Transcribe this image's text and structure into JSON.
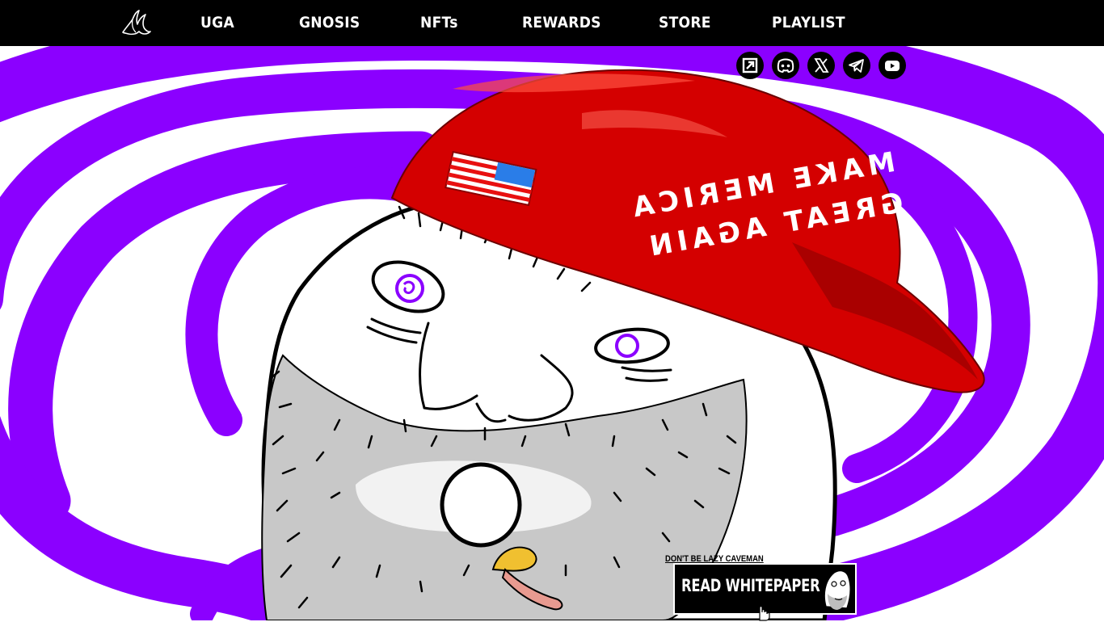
{
  "nav": {
    "logo_icon": "banana-peel-icon",
    "items": [
      {
        "label": "UGA"
      },
      {
        "label": "GNOSIS"
      },
      {
        "label": "NFTs"
      },
      {
        "label": "REWARDS"
      },
      {
        "label": "STORE"
      },
      {
        "label": "PLAYLIST"
      }
    ]
  },
  "socials": [
    {
      "icon": "chart-icon"
    },
    {
      "icon": "discord-icon"
    },
    {
      "icon": "x-icon"
    },
    {
      "icon": "telegram-icon"
    },
    {
      "icon": "youtube-icon"
    }
  ],
  "hero": {
    "cap_text_line1": "MAKE MERICA",
    "cap_text_line2": "GREAT AGAIN"
  },
  "whitepaper": {
    "caption": "DON'T BE LAZY CAVEMAN",
    "button_label": "READ WHITEPAPER"
  },
  "colors": {
    "nav_bg": "#000000",
    "spiral_purple": "#8b00ff",
    "cap_red": "#d40000"
  }
}
